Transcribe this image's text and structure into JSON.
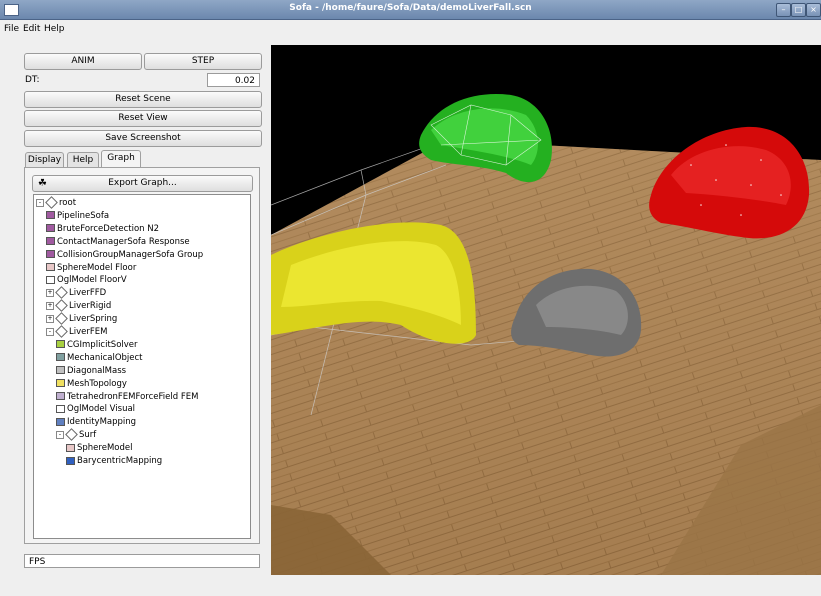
{
  "window": {
    "title": "Sofa - /home/faure/Sofa/Data/demoLiverFall.scn",
    "buttons": [
      "–",
      "□",
      "×"
    ]
  },
  "menubar": {
    "items": [
      "File",
      "Edit",
      "Help"
    ]
  },
  "controls": {
    "anim_label": "ANIM",
    "step_label": "STEP",
    "dt_label": "DT:",
    "dt_value": "0.02",
    "reset_scene_label": "Reset Scene",
    "reset_view_label": "Reset View",
    "save_screenshot_label": "Save Screenshot"
  },
  "tabs": [
    {
      "label": "Display",
      "active": false
    },
    {
      "label": "Help",
      "active": false
    },
    {
      "label": "Graph",
      "active": true
    }
  ],
  "graph": {
    "export_label": "Export Graph...",
    "tree": [
      {
        "label": "root",
        "depth": 0,
        "kind": "node",
        "expander": "-"
      },
      {
        "label": "PipelineSofa",
        "depth": 1,
        "kind": "component",
        "color": "#a05aa0"
      },
      {
        "label": "BruteForceDetection  N2",
        "depth": 1,
        "kind": "component",
        "color": "#a05aa0"
      },
      {
        "label": "ContactManagerSofa  Response",
        "depth": 1,
        "kind": "component",
        "color": "#a05aa0"
      },
      {
        "label": "CollisionGroupManagerSofa  Group",
        "depth": 1,
        "kind": "component",
        "color": "#a05aa0"
      },
      {
        "label": "SphereModel  Floor",
        "depth": 1,
        "kind": "component",
        "color": "#e8c8c8"
      },
      {
        "label": "OglModel  FloorV",
        "depth": 1,
        "kind": "component",
        "color": "#ffffff"
      },
      {
        "label": "LiverFFD",
        "depth": 1,
        "kind": "node",
        "expander": "+"
      },
      {
        "label": "LiverRigid",
        "depth": 1,
        "kind": "node",
        "expander": "+"
      },
      {
        "label": "LiverSpring",
        "depth": 1,
        "kind": "node",
        "expander": "+"
      },
      {
        "label": "LiverFEM",
        "depth": 1,
        "kind": "node",
        "expander": "-"
      },
      {
        "label": "CGImplicitSolver",
        "depth": 2,
        "kind": "component",
        "color": "#a8d040"
      },
      {
        "label": "MechanicalObject",
        "depth": 2,
        "kind": "component",
        "color": "#80a0a0"
      },
      {
        "label": "DiagonalMass",
        "depth": 2,
        "kind": "component",
        "color": "#c0c0c0"
      },
      {
        "label": "MeshTopology",
        "depth": 2,
        "kind": "component",
        "color": "#f0e060"
      },
      {
        "label": "TetrahedronFEMForceField  FEM",
        "depth": 2,
        "kind": "component",
        "color": "#c0b0d0"
      },
      {
        "label": "OglModel  Visual",
        "depth": 2,
        "kind": "component",
        "color": "#ffffff"
      },
      {
        "label": "IdentityMapping",
        "depth": 2,
        "kind": "component",
        "color": "#6080c0"
      },
      {
        "label": "Surf",
        "depth": 2,
        "kind": "node",
        "expander": "-"
      },
      {
        "label": "SphereModel",
        "depth": 3,
        "kind": "component",
        "color": "#e8c8c8"
      },
      {
        "label": "BarycentricMapping",
        "depth": 3,
        "kind": "component",
        "color": "#3060c0"
      }
    ]
  },
  "status": {
    "fps_label": "FPS"
  },
  "icons": {
    "export": "graph-icon"
  }
}
